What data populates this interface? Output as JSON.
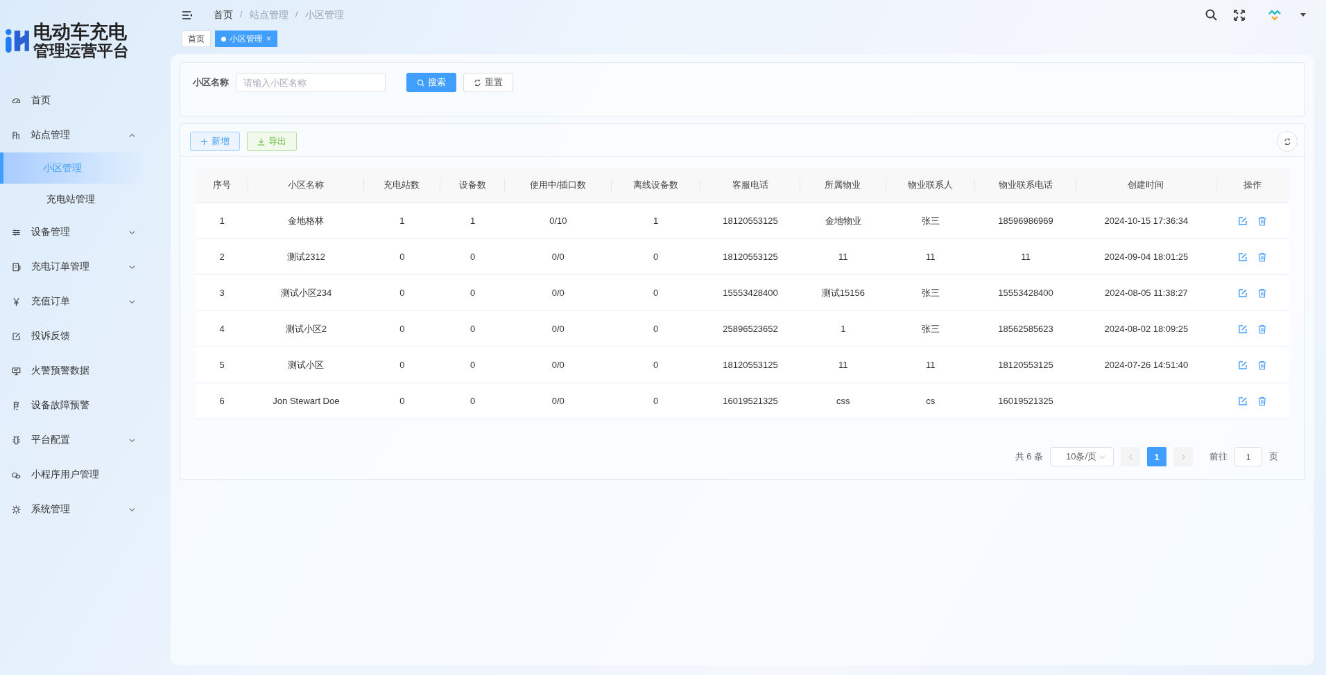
{
  "app": {
    "title_line_1": "电动车充电",
    "title_line_2": "管理运营平台"
  },
  "sidebar": {
    "items": [
      {
        "label": "首页",
        "selected": false
      },
      {
        "label": "站点管理",
        "selected": false,
        "expanded": true,
        "children": [
          {
            "label": "小区管理",
            "selected": true
          },
          {
            "label": "充电站管理",
            "selected": false
          }
        ]
      },
      {
        "label": "设备管理",
        "selected": false,
        "expanded": false
      },
      {
        "label": "充电订单管理",
        "selected": false,
        "expanded": false
      },
      {
        "label": "充值订单",
        "selected": false,
        "expanded": false
      },
      {
        "label": "投诉反馈",
        "selected": false
      },
      {
        "label": "火警预警数据",
        "selected": false
      },
      {
        "label": "设备故障预警",
        "selected": false
      },
      {
        "label": "平台配置",
        "selected": false,
        "expanded": false
      },
      {
        "label": "小程序用户管理",
        "selected": false
      },
      {
        "label": "系统管理",
        "selected": false,
        "expanded": false
      }
    ]
  },
  "breadcrumb": [
    {
      "kind": "link",
      "text": "首页"
    },
    {
      "kind": "separator",
      "text": "/"
    },
    {
      "kind": "current",
      "text": "站点管理"
    },
    {
      "kind": "separator",
      "text": "/"
    },
    {
      "kind": "current",
      "text": "小区管理"
    }
  ],
  "tags": [
    {
      "label": "首页",
      "selected": false
    },
    {
      "label": "小区管理",
      "selected": true,
      "close": "×"
    }
  ],
  "search": {
    "label": "小区名称",
    "placeholder": "请输入小区名称",
    "search_button": "搜索",
    "reset_button": "重置"
  },
  "toolbar": {
    "add_button": "新增",
    "export_button": "导出"
  },
  "table": {
    "columns": [
      "序号",
      "小区名称",
      "充电站数",
      "设备数",
      "使用中/插口数",
      "离线设备数",
      "客服电话",
      "所属物业",
      "物业联系人",
      "物业联系电话",
      "创建时间",
      "操作"
    ],
    "rows": [
      [
        "1",
        "金地格林",
        "1",
        "1",
        "0/10",
        "1",
        "18120553125",
        "金地物业",
        "张三",
        "18596986969",
        "2024-10-15 17:36:34"
      ],
      [
        "2",
        "测试2312",
        "0",
        "0",
        "0/0",
        "0",
        "18120553125",
        "11",
        "11",
        "11",
        "2024-09-04 18:01:25"
      ],
      [
        "3",
        "测试小区234",
        "0",
        "0",
        "0/0",
        "0",
        "15553428400",
        "测试15156",
        "张三",
        "15553428400",
        "2024-08-05 11:38:27"
      ],
      [
        "4",
        "测试小区2",
        "0",
        "0",
        "0/0",
        "0",
        "25896523652",
        "1",
        "张三",
        "18562585623",
        "2024-08-02 18:09:25"
      ],
      [
        "5",
        "测试小区",
        "0",
        "0",
        "0/0",
        "0",
        "18120553125",
        "11",
        "11",
        "18120553125",
        "2024-07-26 14:51:40"
      ],
      [
        "6",
        "Jon Stewart Doe",
        "0",
        "0",
        "0/0",
        "0",
        "16019521325",
        "css",
        "cs",
        "16019521325",
        ""
      ]
    ]
  },
  "pagination": {
    "total": "共 6 条",
    "page_size": "10条/页",
    "pages": [
      {
        "label": "1",
        "selected": true
      }
    ],
    "goto_label": "前往",
    "goto_value": "1",
    "goto_suffix": "页"
  }
}
